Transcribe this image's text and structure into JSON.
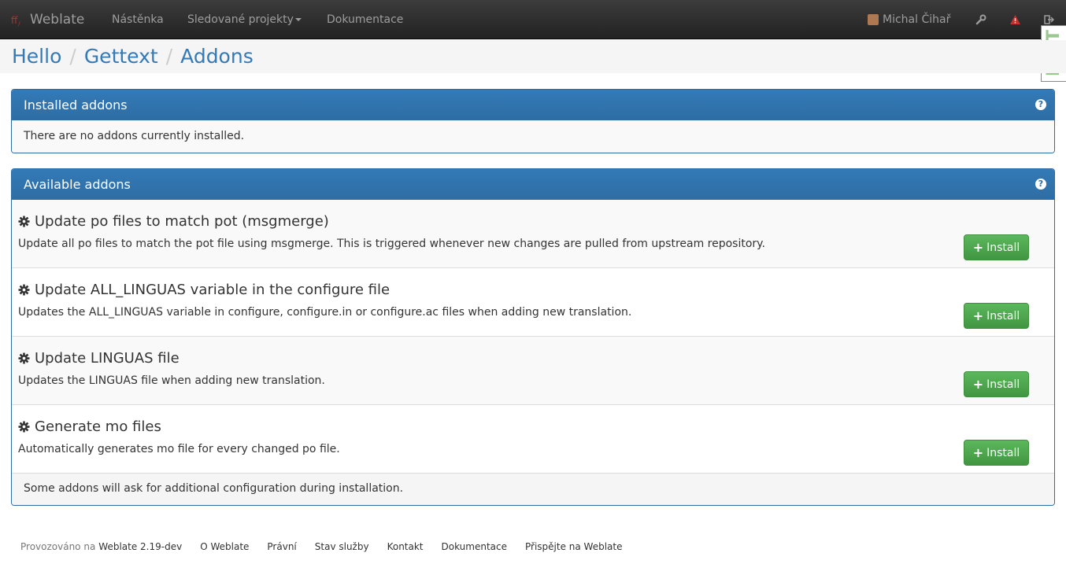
{
  "navbar": {
    "brand": "Weblate",
    "links": [
      "Nástěnka",
      "Sledované projekty",
      "Dokumentace"
    ],
    "user": "Michal Čihař",
    "icons": [
      "wrench-icon",
      "alert-icon",
      "logout-icon"
    ],
    "debug_toolbar": "DjDT"
  },
  "breadcrumb": [
    "Hello",
    "Gettext",
    "Addons"
  ],
  "installed": {
    "title": "Installed addons",
    "empty_text": "There are no addons currently installed."
  },
  "available": {
    "title": "Available addons",
    "addons": [
      {
        "name": "Update po files to match pot (msgmerge)",
        "description": "Update all po files to match the pot file using msgmerge. This is triggered whenever new changes are pulled from upstream repository."
      },
      {
        "name": "Update ALL_LINGUAS variable in the configure file",
        "description": "Updates the ALL_LINGUAS variable in configure, configure.in or configure.ac files when adding new translation."
      },
      {
        "name": "Update LINGUAS file",
        "description": "Updates the LINGUAS file when adding new translation."
      },
      {
        "name": "Generate mo files",
        "description": "Automatically generates mo file for every changed po file."
      }
    ],
    "install_label": "Install",
    "footer_note": "Some addons will ask for additional configuration during installation."
  },
  "footer": {
    "powered_prefix": "Provozováno na",
    "powered_link": "Weblate 2.19-dev",
    "links": [
      "O Weblate",
      "Právní",
      "Stav služby",
      "Kontakt",
      "Dokumentace",
      "Přispějte na Weblate"
    ]
  },
  "colors": {
    "primary": "#337ab7",
    "success": "#5cb85c",
    "navbar": "#222222"
  }
}
